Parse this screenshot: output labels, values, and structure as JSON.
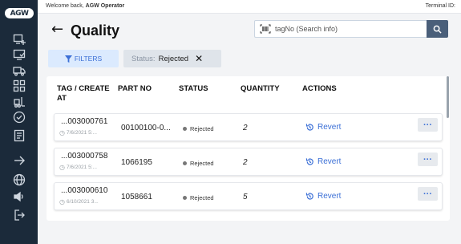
{
  "sidebar": {
    "logo": "AGW",
    "items": [
      {
        "icon": "screen-plus-icon"
      },
      {
        "icon": "screen-check-icon"
      },
      {
        "icon": "truck-icon"
      },
      {
        "icon": "grid-dots-icon"
      },
      {
        "icon": "forklift-icon"
      },
      {
        "icon": "check-circle-icon"
      },
      {
        "icon": "document-list-icon"
      },
      {
        "icon": "arrow-right-icon"
      },
      {
        "icon": "globe-icon"
      },
      {
        "icon": "volume-icon"
      },
      {
        "icon": "logout-icon"
      }
    ]
  },
  "topbar": {
    "welcome_prefix": "Welcome back, ",
    "user": "AGW Operator",
    "terminal": "Terminal ID:"
  },
  "header": {
    "back": "←",
    "title": "Quality"
  },
  "search": {
    "placeholder": "tagNo (Search info)"
  },
  "filters": {
    "button_label": "FILTERS",
    "chip_key": "Status:",
    "chip_value": "Rejected",
    "chip_close": "✕"
  },
  "table": {
    "columns": [
      "TAG / CREATE AT",
      "PART NO",
      "STATUS",
      "QUANTITY",
      "ACTIONS"
    ],
    "rows": [
      {
        "tag": "...003000761",
        "created": "7/6/2021 5:...",
        "part_no": "00100100-0...",
        "status": "Rejected",
        "quantity": "2",
        "action": "Revert",
        "more": "···"
      },
      {
        "tag": "...003000758",
        "created": "7/6/2021 5:...",
        "part_no": "1066195",
        "status": "Rejected",
        "quantity": "2",
        "action": "Revert",
        "more": "···"
      },
      {
        "tag": "...003000610",
        "created": "6/10/2021 3...",
        "part_no": "1058661",
        "status": "Rejected",
        "quantity": "5",
        "action": "Revert",
        "more": "···"
      }
    ]
  },
  "colors": {
    "sidebar": "#1b2a3a",
    "accent": "#3b6fd6",
    "search_button": "#4a5f7a",
    "filter_bg": "#dbeafe"
  }
}
